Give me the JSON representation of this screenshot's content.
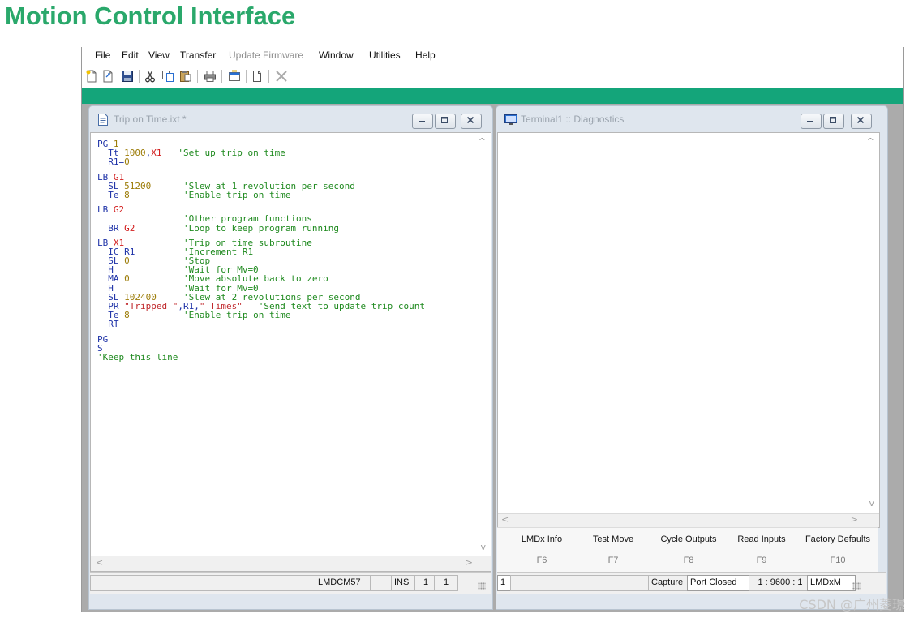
{
  "page": {
    "heading": "Motion Control Interface"
  },
  "menu": [
    "File",
    "Edit",
    "View",
    "Transfer",
    "Update Firmware",
    "Window",
    "Utilities",
    "Help"
  ],
  "toolbar_icons": [
    "new-file-icon",
    "open-file-icon",
    "save-icon",
    "cut-icon",
    "copy-icon",
    "paste-icon",
    "print-icon",
    "properties-icon",
    "new-window-icon",
    "close-x-icon"
  ],
  "colors": {
    "heading": "#2aa86b",
    "accent_bar": "#14a57a",
    "keyword": "#1f33a8",
    "number": "#9c7c08",
    "label": "#d21d1d",
    "comment": "#1f8a1f"
  },
  "editor": {
    "title": "Trip on Time.ixt *",
    "code_lines": [
      "PG 1",
      "  Tt 1000,X1   'Set up trip on time",
      "  R1=0",
      "",
      "LB G1",
      "  SL 51200      'Slew at 1 revolution per second",
      "  Te 8          'Enable trip on time",
      "",
      "LB G2",
      "                'Other program functions",
      "  BR G2         'Loop to keep program running",
      "",
      "LB X1           'Trip on time subroutine",
      "  IC R1         'Increment R1",
      "  SL 0          'Stop",
      "  H             'Wait for Mv=0",
      "  MA 0          'Move absolute back to zero",
      "  H             'Wait for Mv=0",
      "  SL 102400     'Slew at 2 revolutions per second",
      "  PR \"Tripped \",R1,\" Times\"   'Send text to update trip count",
      "  Te 8          'Enable trip on time",
      "  RT",
      "",
      "PG",
      "S",
      "'Keep this line"
    ],
    "status": {
      "device": "LMDCM57",
      "mode": "INS",
      "line": "1",
      "col": "1"
    }
  },
  "terminal": {
    "title": "Terminal1 :: Diagnostics",
    "buttons": [
      "LMDx Info",
      "Test Move",
      "Cycle Outputs",
      "Read Inputs",
      "Factory Defaults"
    ],
    "fkeys": [
      "F6",
      "F7",
      "F8",
      "F9",
      "F10"
    ],
    "status": {
      "line": "1",
      "capture": "Capture",
      "port": "Port Closed",
      "baud": "1 : 9600 : 1",
      "device": "LMDxM"
    }
  },
  "watermark": "CSDN @广州菱璟"
}
